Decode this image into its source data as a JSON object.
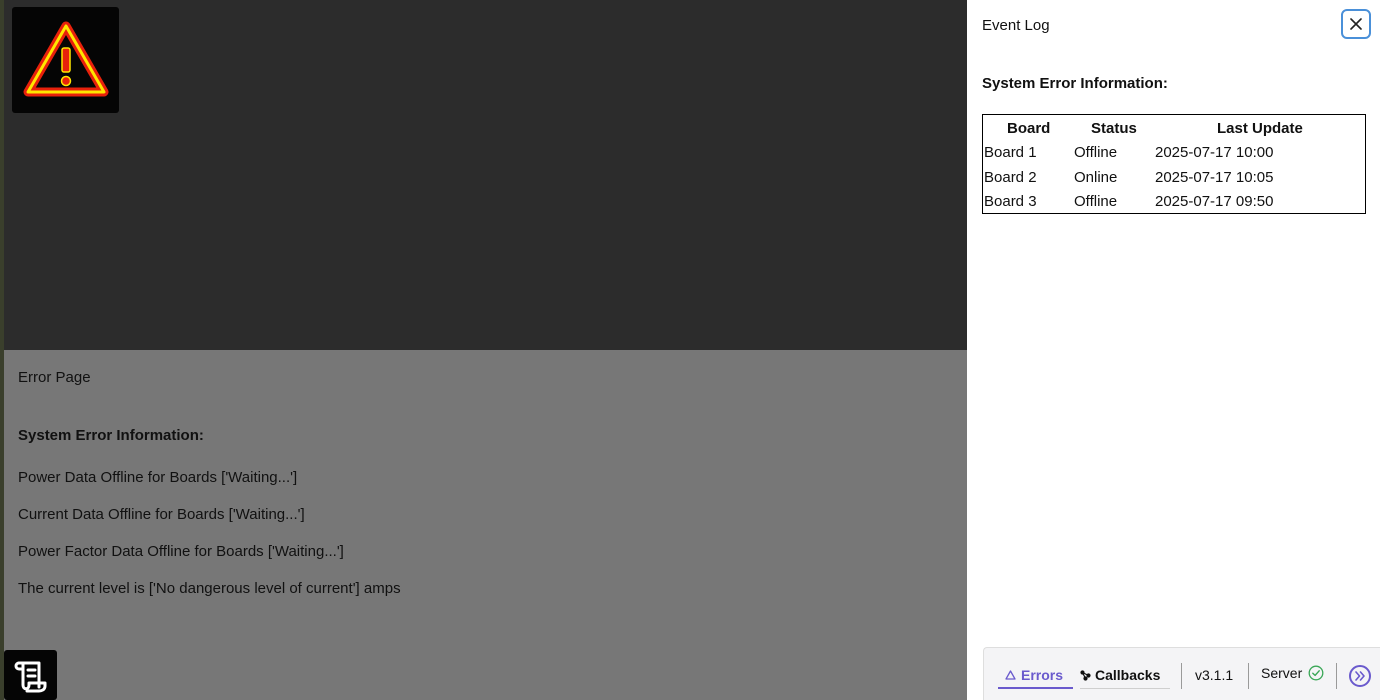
{
  "page": {
    "title": "Error Page",
    "heading": "System Error Information:",
    "messages": [
      "Power Data Offline for Boards ['Waiting...']",
      "Current Data Offline for Boards ['Waiting...']",
      "Power Factor Data Offline for Boards ['Waiting...']",
      "The current level is ['No dangerous level of current'] amps"
    ],
    "warning_icon": "warning-triangle-icon",
    "log_icon": "scroll-icon"
  },
  "panel": {
    "title": "Event Log",
    "heading": "System Error Information:",
    "close_icon": "close-icon",
    "table": {
      "headers": [
        "Board",
        "Status",
        "Last Update"
      ],
      "rows": [
        [
          "Board 1",
          "Offline",
          "2025-07-17 10:00"
        ],
        [
          "Board 2",
          "Online",
          "2025-07-17 10:05"
        ],
        [
          "Board 3",
          "Offline",
          "2025-07-17 09:50"
        ]
      ]
    }
  },
  "footer": {
    "errors_label": "Errors",
    "callbacks_label": "Callbacks",
    "version": "v3.1.1",
    "server_label": "Server",
    "server_status_icon": "check-circle-icon",
    "expand_icon": "double-chevron-right-icon"
  },
  "colors": {
    "accent": "#6a5acd",
    "warning_red": "#e8210b",
    "warning_yellow": "#ffe600",
    "server_ok": "#3aa757",
    "close_border": "#4a90d9"
  }
}
